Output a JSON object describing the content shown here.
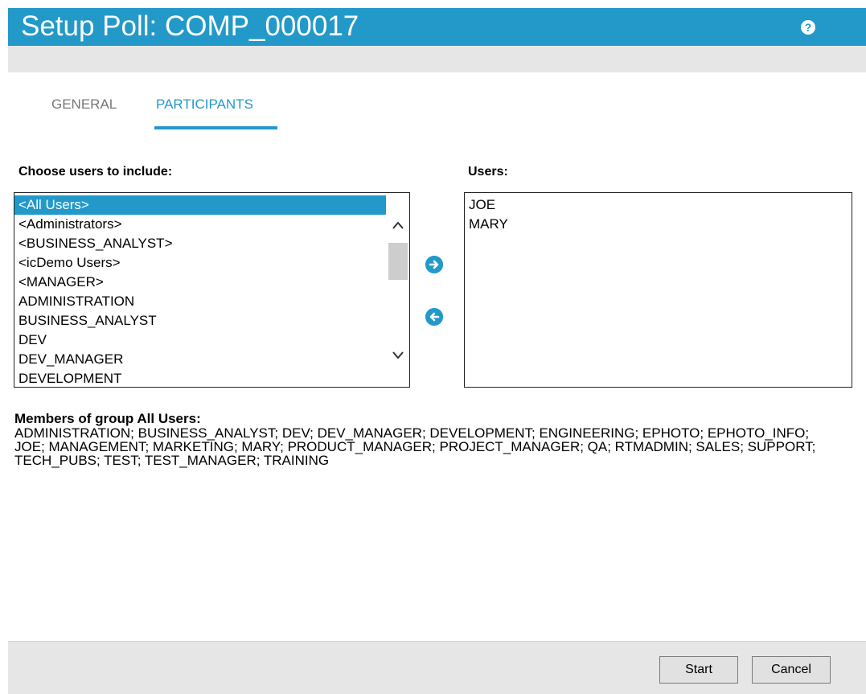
{
  "header": {
    "title": "Setup Poll: COMP_000017",
    "help_icon": "?"
  },
  "tabs": [
    {
      "label": "GENERAL",
      "active": false
    },
    {
      "label": "PARTICIPANTS",
      "active": true
    }
  ],
  "choose_users": {
    "label": "Choose users to include:",
    "items": [
      "<All Users>",
      "<Administrators>",
      "<BUSINESS_ANALYST>",
      "<icDemo Users>",
      "<MANAGER>",
      "ADMINISTRATION",
      "BUSINESS_ANALYST",
      "DEV",
      "DEV_MANAGER",
      "DEVELOPMENT"
    ],
    "selected": "<All Users>",
    "scroll_up_icon": "^",
    "scroll_down_icon": "v"
  },
  "move_buttons": {
    "add_icon": "➜",
    "remove_icon": "⬅"
  },
  "users": {
    "label": "Users:",
    "items": [
      "JOE",
      "MARY"
    ]
  },
  "members": {
    "label": "Members of group All Users:",
    "text": "ADMINISTRATION; BUSINESS_ANALYST; DEV; DEV_MANAGER; DEVELOPMENT; ENGINEERING; EPHOTO; EPHOTO_INFO; JOE; MANAGEMENT; MARKETING; MARY; PRODUCT_MANAGER; PROJECT_MANAGER; QA; RTMADMIN; SALES; SUPPORT; TECH_PUBS; TEST; TEST_MANAGER; TRAINING"
  },
  "footer": {
    "start_label": "Start",
    "cancel_label": "Cancel"
  },
  "colors": {
    "accent": "#2299c9",
    "bar_gray": "#e6e6e6"
  }
}
